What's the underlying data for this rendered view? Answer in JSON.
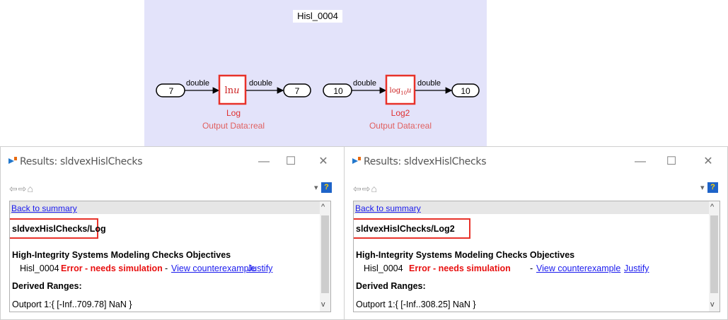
{
  "model": {
    "title": "Hisl_0004",
    "block1": {
      "input_value": "7",
      "output_value": "7",
      "in_signal": "double",
      "out_signal": "double",
      "name": "Log",
      "output_note": "Output Data:real"
    },
    "block2": {
      "input_value": "10",
      "output_value": "10",
      "in_signal": "double",
      "out_signal": "double",
      "name": "Log2",
      "output_note": "Output Data:real"
    },
    "colors": {
      "canvas": "#e3e3fa",
      "block_border": "#e8322a",
      "block_label": "#e03030"
    }
  },
  "windows": [
    {
      "title": "Results: sldvexHislChecks",
      "back_link": "Back to summary",
      "path": "sldvexHislChecks/Log",
      "objectives_heading": "High-Integrity Systems Modeling Checks Objectives",
      "objective_id": "Hisl_0004",
      "status": "Error - needs simulation",
      "dash": "-",
      "view_link": "View counterexample",
      "justify_link": "Justify",
      "ranges_heading": "Derived Ranges:",
      "outport": "Outport 1:{ [-Inf..709.78] NaN }"
    },
    {
      "title": "Results: sldvexHislChecks",
      "back_link": "Back to summary",
      "path": "sldvexHislChecks/Log2",
      "objectives_heading": "High-Integrity Systems Modeling Checks Objectives",
      "objective_id": "Hisl_0004",
      "status": "Error - needs simulation",
      "dash": "-",
      "view_link": "View counterexample",
      "justify_link": "Justify",
      "ranges_heading": "Derived Ranges:",
      "outport": "Outport 1:{ [-Inf..308.25] NaN }"
    }
  ],
  "window_controls": {
    "minimize": "—",
    "maximize": "☐",
    "close": "✕",
    "nav_icons": "⇦⇨⌂",
    "dropdown_icon": "▾",
    "help_icon": "?",
    "scroll_up": "^",
    "scroll_down": "v"
  },
  "accent_colors": {
    "error": "#e81010",
    "link": "#1a1aee",
    "highlight": "#e8322a"
  }
}
